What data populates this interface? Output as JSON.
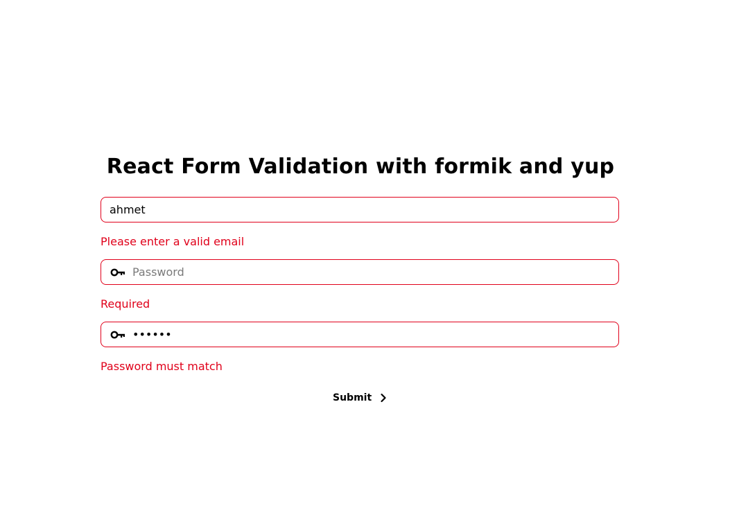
{
  "form": {
    "title": "React Form Validation with formik and yup",
    "email": {
      "value": "ahmet",
      "error": "Please enter a valid email"
    },
    "password": {
      "value": "",
      "placeholder": "Password",
      "error": "Required"
    },
    "confirm_password": {
      "value": "aaaaaa",
      "error": "Password must match"
    },
    "submit_label": "Submit"
  },
  "icons": {
    "password_icon": "key-icon",
    "confirm_icon": "key-icon",
    "submit_icon": "chevron-right-icon"
  },
  "colors": {
    "error": "#e0001a",
    "text": "#000000",
    "background": "#ffffff"
  }
}
